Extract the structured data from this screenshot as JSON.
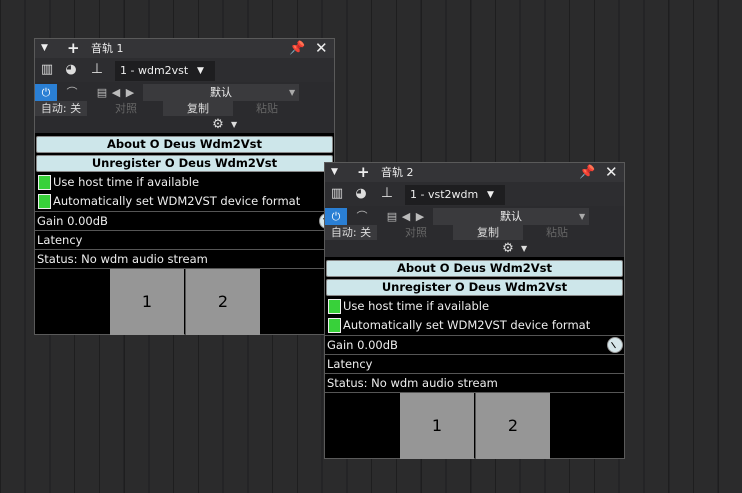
{
  "windows": [
    {
      "title": "音轨 1",
      "preset_device": "1 - wdm2vst",
      "auto_label": "自动: 关",
      "compare_label": "对照",
      "copy_label": "复制",
      "paste_label": "粘贴",
      "preset_label": "默认",
      "about_label": "About O Deus Wdm2Vst",
      "unregister_label": "Unregister O Deus Wdm2Vst",
      "use_host_time": "Use host time if available",
      "auto_set": "Automatically set WDM2VST device format",
      "gain": "Gain 0.00dB",
      "latency": "Latency",
      "status": "Status: No wdm audio stream",
      "channels": [
        "1",
        "2"
      ]
    },
    {
      "title": "音轨 2",
      "preset_device": "1 - vst2wdm",
      "auto_label": "自动: 关",
      "compare_label": "对照",
      "copy_label": "复制",
      "paste_label": "粘贴",
      "preset_label": "默认",
      "about_label": "About O Deus Wdm2Vst",
      "unregister_label": "Unregister O Deus Wdm2Vst",
      "use_host_time": "Use host time if available",
      "auto_set": "Automatically set WDM2VST device format",
      "gain": "Gain 0.00dB",
      "latency": "Latency",
      "status": "Status: No wdm audio stream",
      "channels": [
        "1",
        "2"
      ]
    }
  ],
  "icons": {
    "collapse": "triangle-down-icon",
    "add": "plus-icon",
    "pin": "pin-icon",
    "close": "close-icon",
    "power": "power-icon",
    "gear": "gear-icon"
  },
  "colors": {
    "power_active": "#2a7fd4",
    "checkbox": "#38d13a",
    "button_bg": "#cde6ea",
    "channel_box": "#969696"
  }
}
